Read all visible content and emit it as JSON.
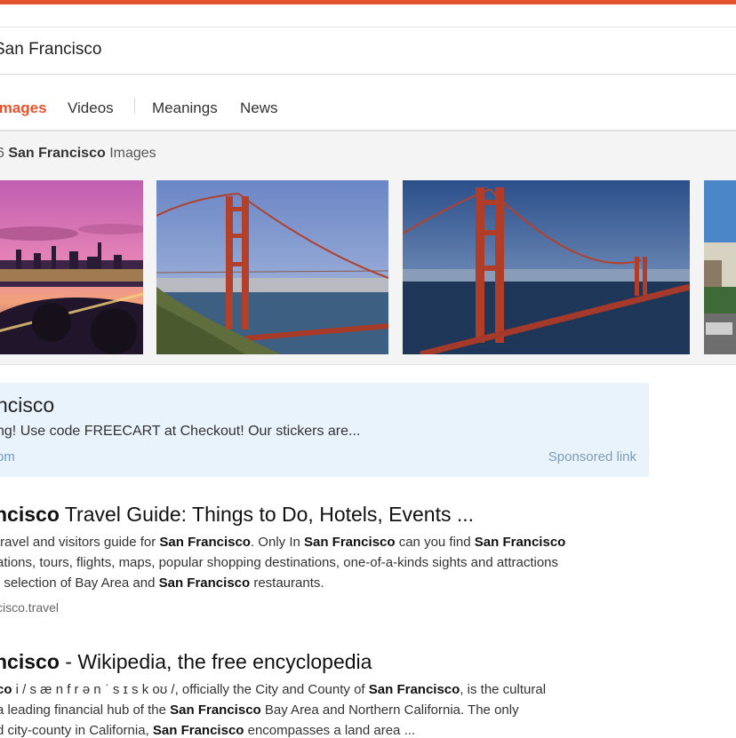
{
  "search": {
    "query": "San Francisco"
  },
  "tabs": [
    {
      "label": "Images",
      "active": true
    },
    {
      "label": "Videos",
      "active": false
    },
    {
      "label": "Meanings",
      "active": false
    },
    {
      "label": "News",
      "active": false
    }
  ],
  "images": {
    "count_prefix": "6",
    "count_bold": "San Francisco",
    "count_suffix": "Images"
  },
  "ad": {
    "title": "ncisco",
    "description": "ng! Use code FREECART at Checkout! Our stickers are...",
    "url": "om",
    "sponsored_label": "Sponsored link"
  },
  "results": [
    {
      "title_bold": "ncisco",
      "title_rest": " Travel Guide: Things to Do, Hotels, Events ...",
      "line1": [
        {
          "t": "travel and visitors guide for ",
          "b": false
        },
        {
          "t": "San Francisco",
          "b": true
        },
        {
          "t": ". Only In ",
          "b": false
        },
        {
          "t": "San Francisco",
          "b": true
        },
        {
          "t": " can you find ",
          "b": false
        },
        {
          "t": "San Francisco",
          "b": true
        }
      ],
      "line2": [
        {
          "t": "ations, tours, flights, maps, popular shopping destinations, one-of-a-kinds sights and attractions",
          "b": false
        }
      ],
      "line3": [
        {
          "t": "t selection of Bay Area and ",
          "b": false
        },
        {
          "t": "San Francisco",
          "b": true
        },
        {
          "t": " restaurants.",
          "b": false
        }
      ],
      "url": "cisco.travel"
    },
    {
      "title_bold": "ncisco",
      "title_rest": " - Wikipedia, the free encyclopedia",
      "line1": [
        {
          "t": "co",
          "b": true
        },
        {
          "t": " i / s æ n f r ə n ˈ s ɪ s k oʊ /, officially the City and County of ",
          "b": false
        },
        {
          "t": "San Francisco",
          "b": true
        },
        {
          "t": ", is the cultural",
          "b": false
        }
      ],
      "line2": [
        {
          "t": "a leading financial hub of the ",
          "b": false
        },
        {
          "t": "San Francisco",
          "b": true
        },
        {
          "t": " Bay Area and Northern California. The only",
          "b": false
        }
      ],
      "line3": [
        {
          "t": "d city-county in California, ",
          "b": false
        },
        {
          "t": "San Francisco",
          "b": true
        },
        {
          "t": " encompasses a land area ...",
          "b": false
        }
      ]
    }
  ]
}
